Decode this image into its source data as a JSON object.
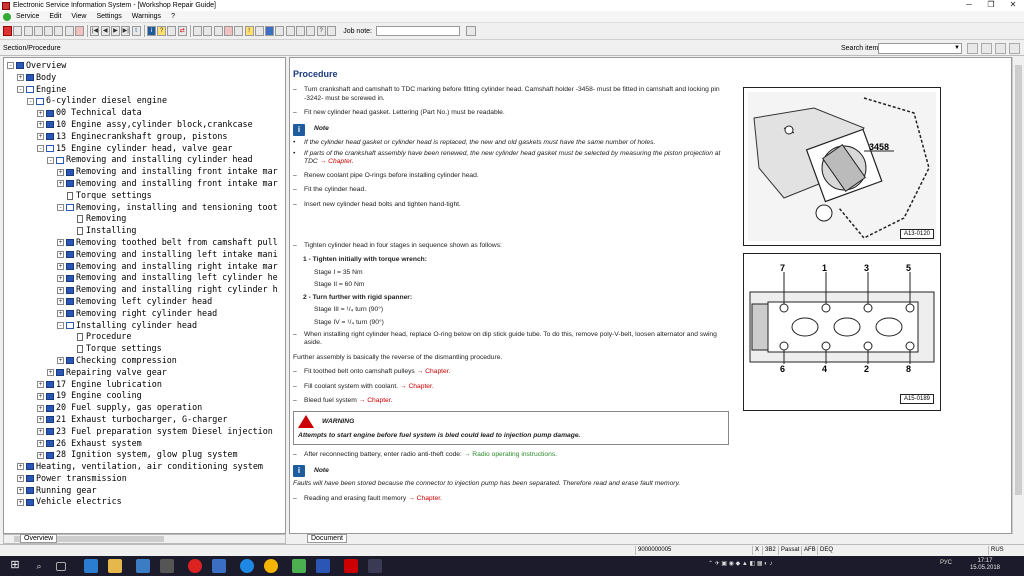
{
  "window": {
    "title": "Electronic Service Information System - [Workshop Repair Guide]"
  },
  "menu": [
    "Service",
    "Edit",
    "View",
    "Settings",
    "Warnings",
    "?"
  ],
  "toolbar": {
    "job_note_label": "Job note:"
  },
  "section_label": "Section/Procedure",
  "search_label": "Search item:",
  "tree": [
    {
      "level": 0,
      "exp": "-",
      "icon": "book",
      "text": "Overview"
    },
    {
      "level": 1,
      "exp": "+",
      "icon": "book",
      "text": "Body"
    },
    {
      "level": 1,
      "exp": "-",
      "icon": "bookopen",
      "text": "Engine"
    },
    {
      "level": 2,
      "exp": "-",
      "icon": "bookopen",
      "text": "6-cylinder diesel engine"
    },
    {
      "level": 3,
      "exp": "+",
      "icon": "book",
      "text": "00 Technical data"
    },
    {
      "level": 3,
      "exp": "+",
      "icon": "book",
      "text": "10 Engine assy,cylinder block,crankcase"
    },
    {
      "level": 3,
      "exp": "+",
      "icon": "book",
      "text": "13 Enginecrankshaft group, pistons"
    },
    {
      "level": 3,
      "exp": "-",
      "icon": "bookopen",
      "text": "15 Engine cylinder head, valve gear"
    },
    {
      "level": 4,
      "exp": "-",
      "icon": "bookopen",
      "text": "Removing and installing cylinder head"
    },
    {
      "level": 5,
      "exp": "+",
      "icon": "book",
      "text": "Removing and installing front intake mar"
    },
    {
      "level": 5,
      "exp": "+",
      "icon": "book",
      "text": "Removing and installing front intake mar"
    },
    {
      "level": 5,
      "exp": "",
      "icon": "doc",
      "text": "Torque settings"
    },
    {
      "level": 5,
      "exp": "-",
      "icon": "bookopen",
      "text": "Removing, installing and tensioning toot"
    },
    {
      "level": 6,
      "exp": "",
      "icon": "doc",
      "text": "Removing"
    },
    {
      "level": 6,
      "exp": "",
      "icon": "doc",
      "text": "Installing"
    },
    {
      "level": 5,
      "exp": "+",
      "icon": "book",
      "text": "Removing toothed belt from camshaft pull"
    },
    {
      "level": 5,
      "exp": "+",
      "icon": "book",
      "text": "Removing and installing left intake mani"
    },
    {
      "level": 5,
      "exp": "+",
      "icon": "book",
      "text": "Removing and installing right intake mar"
    },
    {
      "level": 5,
      "exp": "+",
      "icon": "book",
      "text": "Removing and installing left cylinder he"
    },
    {
      "level": 5,
      "exp": "+",
      "icon": "book",
      "text": "Removing and installing right cylinder h"
    },
    {
      "level": 5,
      "exp": "+",
      "icon": "book",
      "text": "Removing left cylinder head"
    },
    {
      "level": 5,
      "exp": "+",
      "icon": "book",
      "text": "Removing right cylinder head"
    },
    {
      "level": 5,
      "exp": "-",
      "icon": "bookopen",
      "text": "Installing cylinder head"
    },
    {
      "level": 6,
      "exp": "",
      "icon": "doc",
      "text": "Procedure"
    },
    {
      "level": 6,
      "exp": "",
      "icon": "doc",
      "text": "Torque settings"
    },
    {
      "level": 5,
      "exp": "+",
      "icon": "book",
      "text": "Checking compression"
    },
    {
      "level": 4,
      "exp": "+",
      "icon": "book",
      "text": "Repairing valve gear"
    },
    {
      "level": 3,
      "exp": "+",
      "icon": "book",
      "text": "17 Engine lubrication"
    },
    {
      "level": 3,
      "exp": "+",
      "icon": "book",
      "text": "19 Engine cooling"
    },
    {
      "level": 3,
      "exp": "+",
      "icon": "book",
      "text": "20 Fuel supply, gas operation"
    },
    {
      "level": 3,
      "exp": "+",
      "icon": "book",
      "text": "21 Exhaust turbocharger, G-charger"
    },
    {
      "level": 3,
      "exp": "+",
      "icon": "book",
      "text": "23 Fuel preparation system Diesel injection"
    },
    {
      "level": 3,
      "exp": "+",
      "icon": "book",
      "text": "26 Exhaust system"
    },
    {
      "level": 3,
      "exp": "+",
      "icon": "book",
      "text": "28 Ignition system, glow plug system"
    },
    {
      "level": 1,
      "exp": "+",
      "icon": "book",
      "text": "Heating, ventilation, air conditioning system"
    },
    {
      "level": 1,
      "exp": "+",
      "icon": "book",
      "text": "Power transmission"
    },
    {
      "level": 1,
      "exp": "+",
      "icon": "book",
      "text": "Running gear"
    },
    {
      "level": 1,
      "exp": "+",
      "icon": "book",
      "text": "Vehicle electrics"
    }
  ],
  "left_tab": "Overview",
  "right_tab": "Document",
  "doc": {
    "heading": "Procedure",
    "step1": "Turn crankshaft and camshaft to TDC marking before fitting cylinder head. Camshaft holder -3458- must be fitted in camshaft and locking pin -3242- must be screwed in.",
    "step2": "Fit new cylinder head gasket. Lettering (Part No.) must be readable.",
    "note1_label": "Note",
    "note1_b1": "If the cylinder head gasket or cylinder head is replaced, the new and old gaskets must have the same number of holes.",
    "note1_b2": "If parts of the crankshaft assembly have been renewed, the new cylinder head gasket must be selected by measuring the piston projection at TDC",
    "chapter": "→ Chapter.",
    "step3": "Renew coolant pipe O-rings before installing cylinder head.",
    "step4": "Fit the cylinder head.",
    "step5": "Insert new cylinder head bolts and tighten hand-tight.",
    "step6": "Tighten cylinder head in four stages in sequence shown as follows:",
    "sub1_num": "1 -",
    "sub1_head": "Tighten initially with torque wrench:",
    "stage1": "Stage I = 35 Nm",
    "stage2": "Stage II = 60 Nm",
    "sub2_num": "2 -",
    "sub2_head": "Turn further with rigid spanner:",
    "stage3": "Stage III = ¹/₄ turn (90°)",
    "stage4": "Stage IV = ¹/₄ turn (90°)",
    "step7": "When installing right cylinder head, replace O-ring below on dip stick guide tube. To do this, remove poly-V-belt, loosen alternator and swing aside.",
    "further": "Further assembly is basically the reverse of the dismantling procedure.",
    "step8": "Fit toothed belt onto camshaft pulleys",
    "step9": "Fill coolant system with coolant.",
    "step10": "Bleed fuel system",
    "warning_label": "WARNING",
    "warning_text": "Attempts to start engine before fuel system is bled could lead to injection pump damage.",
    "step11": "After reconnecting battery, enter radio anti-theft code:",
    "radio_link": "→ Radio operating instructions.",
    "note2_label": "Note",
    "note2_text": "Faults will have been stored because the connector to injection pump has been separated. Therefore read and erase fault memory.",
    "step12": "Reading and erasing fault memory"
  },
  "figures": {
    "fig1_tool": "3458",
    "fig1_label": "A13-0120",
    "fig2_label": "A15-0189",
    "fig2_top": [
      "7",
      "1",
      "3",
      "5"
    ],
    "fig2_bottom": [
      "6",
      "4",
      "2",
      "8"
    ]
  },
  "status": {
    "code": "9000000005",
    "x": "X",
    "s1": "3B2",
    "s2": "Passat",
    "s3": "AFB",
    "s4": "DEQ",
    "lang": "RUS"
  },
  "taskbar": {
    "time": "17:17",
    "date": "15.05.2018",
    "lang": "РУС"
  }
}
